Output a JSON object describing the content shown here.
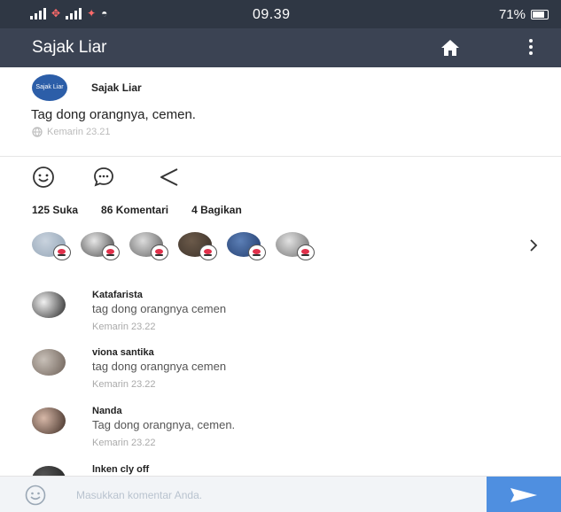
{
  "status_bar": {
    "time": "09.39",
    "battery": "71%",
    "battery_level": 0.71,
    "icons": [
      "signal-bars-icon",
      "data-transfer-icon",
      "signal-bars-icon",
      "notification-icon",
      "wifi-icon",
      "battery-icon"
    ]
  },
  "app_bar": {
    "title": "Sajak Liar",
    "icons": [
      "home-icon",
      "more-vertical-icon"
    ],
    "color": "#3b4353"
  },
  "post": {
    "avatar_text": "Sajak Liar",
    "author": "Sajak Liar",
    "text": "Tag dong orangnya, cemen.",
    "timestamp": "Kemarin 23.21",
    "visibility_icon": "globe-icon"
  },
  "actions": {
    "icons": [
      "smile-icon",
      "comment-icon",
      "share-icon"
    ]
  },
  "stats": {
    "likes": "125 Suka",
    "comments": "86 Komentari",
    "shares": "4 Bagikan"
  },
  "likers": [
    {
      "colors": [
        "#c9d3de",
        "#8fa1b3"
      ]
    },
    {
      "colors": [
        "#e7e7e7",
        "#444444"
      ]
    },
    {
      "colors": [
        "#dcdcdc",
        "#5d5d5d"
      ]
    },
    {
      "colors": [
        "#6b5a4a",
        "#3a3028"
      ]
    },
    {
      "colors": [
        "#5c7fb6",
        "#1f3a6b"
      ]
    },
    {
      "colors": [
        "#e2e2e2",
        "#6a6a6a"
      ]
    }
  ],
  "comments": [
    {
      "name": "Katafarista",
      "text": "tag dong orangnya cemen",
      "time": "Kemarin 23.22",
      "colors": [
        "#f1f1f1",
        "#222222"
      ]
    },
    {
      "name": "viona santika",
      "text": "tag dong orangnya cemen",
      "time": "Kemarin 23.22",
      "colors": [
        "#c8c0b8",
        "#6b5e55"
      ]
    },
    {
      "name": "Nanda",
      "text": "Tag dong orangnya, cemen.",
      "time": "Kemarin 23.22",
      "colors": [
        "#d7b8a8",
        "#3b2a22"
      ]
    },
    {
      "name": "lnken cly off",
      "text": "",
      "time": "",
      "colors": [
        "#555555",
        "#222222"
      ]
    }
  ],
  "input": {
    "placeholder": "Masukkan komentar Anda.",
    "value": "",
    "send_color": "#4f8fe0"
  }
}
